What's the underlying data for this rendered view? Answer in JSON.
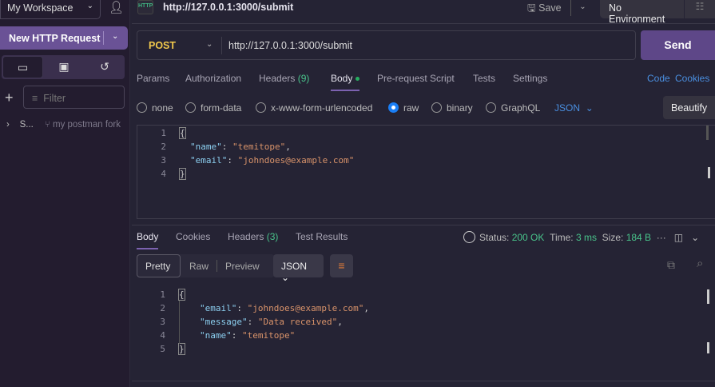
{
  "sidebar": {
    "workspace": "My Workspace",
    "new_request": "New HTTP Request",
    "filter_placeholder": "Filter",
    "collection_name": "S...",
    "fork_label": "my postman fork",
    "icons": [
      "collections-icon",
      "environments-icon",
      "history-icon"
    ]
  },
  "topbar": {
    "tab_title": "http://127.0.0.1:3000/submit",
    "save": "Save",
    "environment": "No Environment",
    "http_badge": "HTTP"
  },
  "request": {
    "method": "POST",
    "url": "http://127.0.0.1:3000/submit",
    "send": "Send",
    "tabs": [
      {
        "label": "Params"
      },
      {
        "label": "Authorization"
      },
      {
        "label": "Headers",
        "count": "(9)"
      },
      {
        "label": "Body",
        "active": true
      },
      {
        "label": "Pre-request Script"
      },
      {
        "label": "Tests"
      },
      {
        "label": "Settings"
      }
    ],
    "links": {
      "code": "Code",
      "cookies": "Cookies"
    },
    "body_types": [
      "none",
      "form-data",
      "x-www-form-urlencoded",
      "raw",
      "binary",
      "GraphQL"
    ],
    "selected_body_type": "raw",
    "format": "JSON",
    "beautify": "Beautify",
    "body_lines": [
      "1",
      "2",
      "3",
      "4"
    ],
    "body": {
      "name": "temitope",
      "email": "johndoes@example.com"
    }
  },
  "response": {
    "tabs": [
      {
        "label": "Body",
        "active": true
      },
      {
        "label": "Cookies"
      },
      {
        "label": "Headers",
        "count": "(3)"
      },
      {
        "label": "Test Results"
      }
    ],
    "status_label": "Status:",
    "status": "200 OK",
    "time_label": "Time:",
    "time": "3 ms",
    "size_label": "Size:",
    "size": "184 B",
    "views": [
      "Pretty",
      "Raw",
      "Preview"
    ],
    "format": "JSON",
    "lines": [
      "1",
      "2",
      "3",
      "4",
      "5"
    ],
    "body": {
      "email": "johndoes@example.com",
      "message": "Data received",
      "name": "temitope"
    }
  },
  "colors": {
    "accent": "#6a5296",
    "method": "#f2c94c",
    "status": "#49c48b",
    "link": "#4a8fe0"
  }
}
